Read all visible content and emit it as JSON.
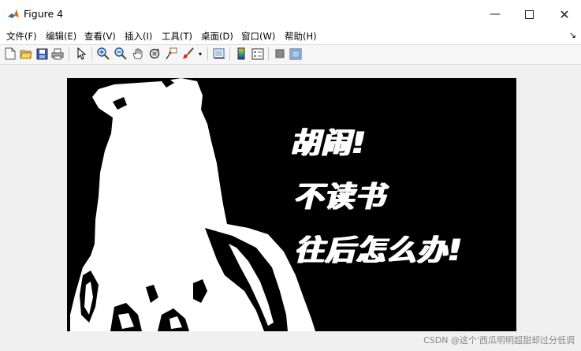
{
  "window": {
    "title": "Figure 4"
  },
  "menu": {
    "file": "文件(F)",
    "edit": "编辑(E)",
    "view": "查看(V)",
    "insert": "插入(I)",
    "tools": "工具(T)",
    "desktop": "桌面(D)",
    "window": "窗口(W)",
    "help": "帮助(H)",
    "arrow": "↘"
  },
  "toolbar_icons": [
    "new-figure-icon",
    "open-file-icon",
    "save-icon",
    "print-icon",
    "pointer-icon",
    "zoom-in-icon",
    "zoom-out-icon",
    "pan-icon",
    "rotate-3d-icon",
    "data-cursor-icon",
    "brush-icon",
    "link-plot-icon",
    "colorbar-icon",
    "legend-icon",
    "hide-plot-tools-icon",
    "show-plot-tools-icon"
  ],
  "image": {
    "line1": "胡闹!",
    "line2": "不读书",
    "line3": "往后怎么办!"
  },
  "watermark": "CSDN @这个'西瓜明明超甜却过分低调"
}
